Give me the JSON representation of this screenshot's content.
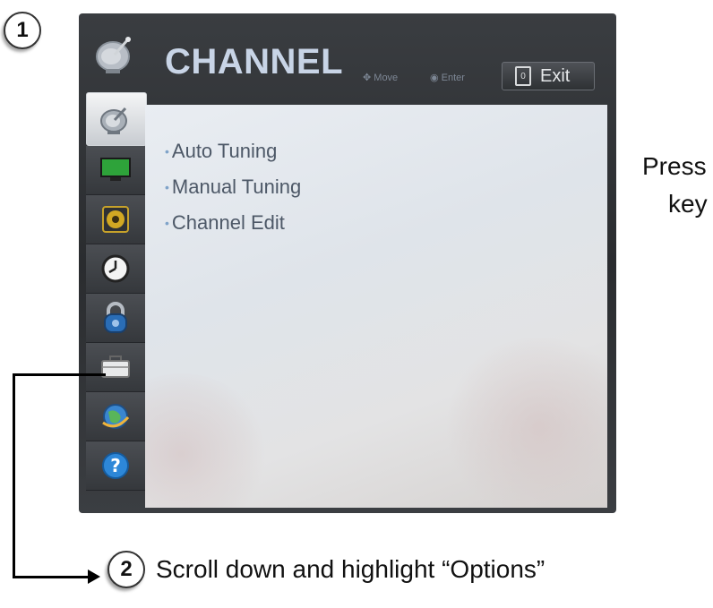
{
  "step_markers": [
    "1",
    "2"
  ],
  "tv_menu": {
    "title": "CHANNEL",
    "hints": {
      "move": "Move",
      "enter": "Enter"
    },
    "exit_label": "Exit",
    "exit_key_glyph": "0",
    "items": [
      "Auto Tuning",
      "Manual Tuning",
      "Channel Edit"
    ],
    "sidebar_icons": [
      "satellite-dish-icon",
      "picture-icon",
      "speaker-icon",
      "clock-icon",
      "lock-icon",
      "toolbox-icon",
      "globe-icon",
      "help-icon"
    ]
  },
  "instructions": {
    "press_line1": "Press",
    "press_line2": "key",
    "step2": "Scroll down and highlight “Options”"
  },
  "colors": {
    "menu_text": "#4d5867",
    "title_text": "#c8d4e6",
    "bullet": "#7fa3c9"
  }
}
